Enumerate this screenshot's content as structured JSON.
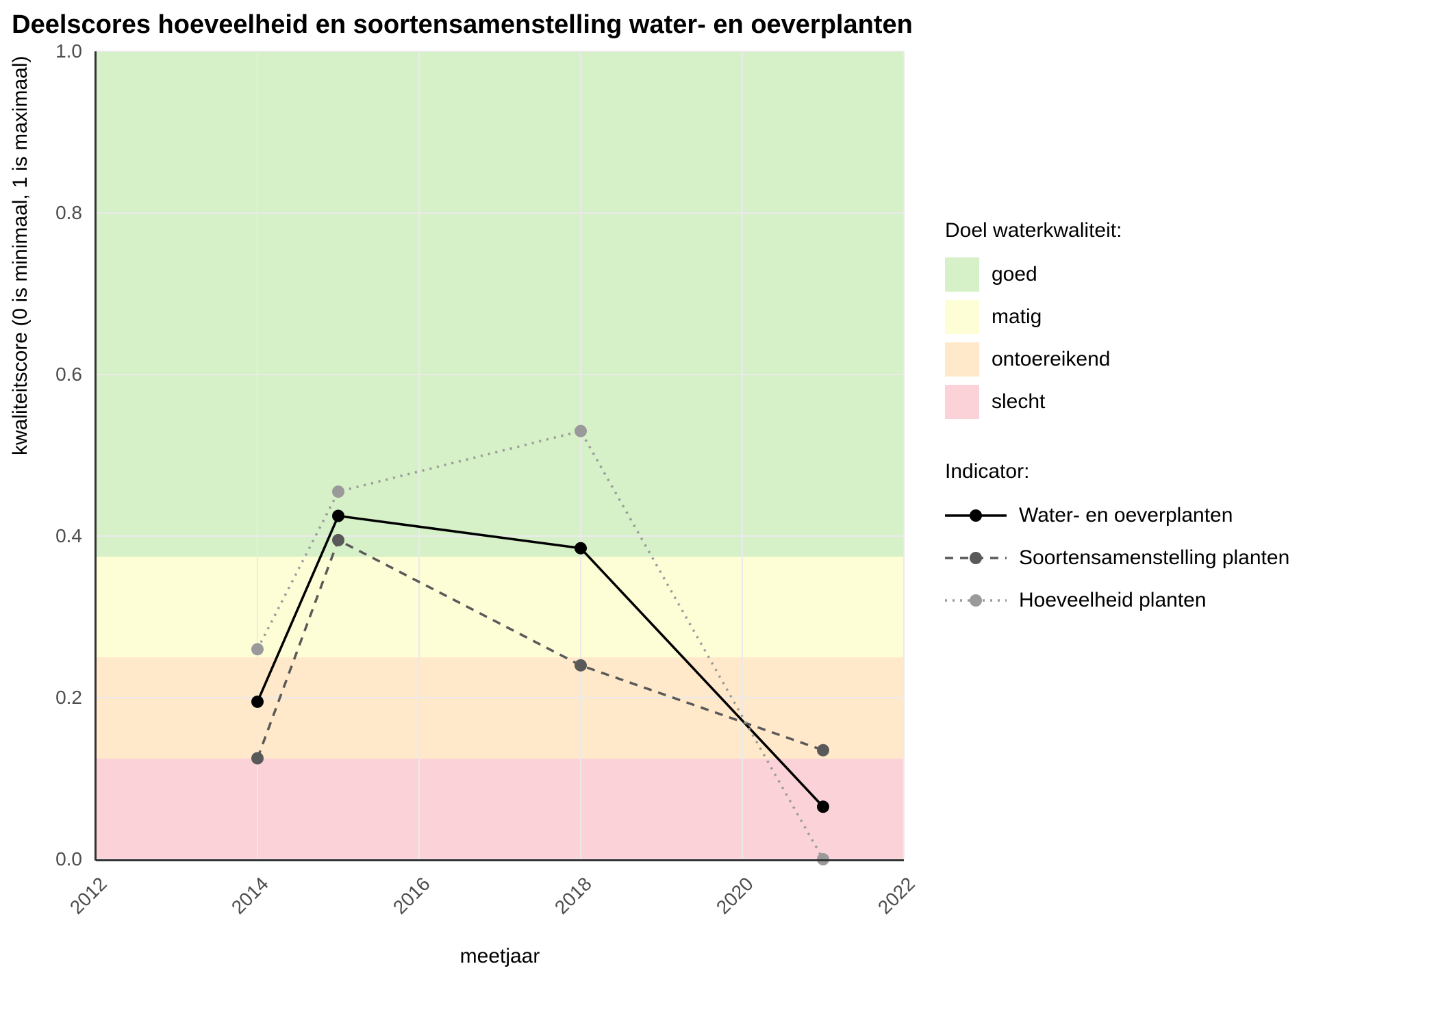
{
  "chart_data": {
    "type": "line",
    "title": "Deelscores hoeveelheid en soortensamenstelling water- en oeverplanten",
    "xlabel": "meetjaar",
    "ylabel": "kwaliteitscore (0 is minimaal, 1 is maximaal)",
    "xlim": [
      2012,
      2022
    ],
    "ylim": [
      0,
      1
    ],
    "x_ticks": [
      2012,
      2014,
      2016,
      2018,
      2020,
      2022
    ],
    "y_ticks": [
      0.0,
      0.2,
      0.4,
      0.6,
      0.8,
      1.0
    ],
    "bands": [
      {
        "name": "goed",
        "from": 0.375,
        "to": 1.0,
        "color": "#d6f0c8"
      },
      {
        "name": "matig",
        "from": 0.25,
        "to": 0.375,
        "color": "#fdfdd6"
      },
      {
        "name": "ontoereikend",
        "from": 0.125,
        "to": 0.25,
        "color": "#ffe9ca"
      },
      {
        "name": "slecht",
        "from": 0.0,
        "to": 0.125,
        "color": "#fbd2d8"
      }
    ],
    "series": [
      {
        "name": "Water- en oeverplanten",
        "dash": "solid",
        "color": "#000000",
        "x": [
          2014,
          2015,
          2018,
          2021
        ],
        "y": [
          0.195,
          0.425,
          0.385,
          0.065
        ]
      },
      {
        "name": "Soortensamenstelling planten",
        "dash": "dashed",
        "color": "#595959",
        "x": [
          2014,
          2015,
          2018,
          2021
        ],
        "y": [
          0.125,
          0.395,
          0.24,
          0.135
        ]
      },
      {
        "name": "Hoeveelheid planten",
        "dash": "dotted",
        "color": "#9a9a9a",
        "x": [
          2014,
          2015,
          2018,
          2021
        ],
        "y": [
          0.26,
          0.455,
          0.53,
          0.0
        ]
      }
    ],
    "legend_fill_title": "Doel waterkwaliteit:",
    "legend_line_title": "Indicator:"
  }
}
